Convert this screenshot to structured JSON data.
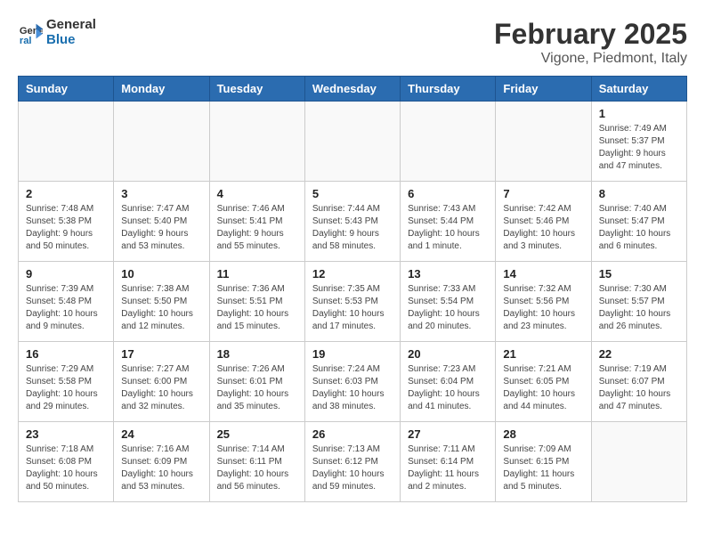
{
  "header": {
    "logo_line1": "General",
    "logo_line2": "Blue",
    "main_title": "February 2025",
    "subtitle": "Vigone, Piedmont, Italy"
  },
  "days_of_week": [
    "Sunday",
    "Monday",
    "Tuesday",
    "Wednesday",
    "Thursday",
    "Friday",
    "Saturday"
  ],
  "weeks": [
    [
      {
        "day": "",
        "info": ""
      },
      {
        "day": "",
        "info": ""
      },
      {
        "day": "",
        "info": ""
      },
      {
        "day": "",
        "info": ""
      },
      {
        "day": "",
        "info": ""
      },
      {
        "day": "",
        "info": ""
      },
      {
        "day": "1",
        "info": "Sunrise: 7:49 AM\nSunset: 5:37 PM\nDaylight: 9 hours and 47 minutes."
      }
    ],
    [
      {
        "day": "2",
        "info": "Sunrise: 7:48 AM\nSunset: 5:38 PM\nDaylight: 9 hours and 50 minutes."
      },
      {
        "day": "3",
        "info": "Sunrise: 7:47 AM\nSunset: 5:40 PM\nDaylight: 9 hours and 53 minutes."
      },
      {
        "day": "4",
        "info": "Sunrise: 7:46 AM\nSunset: 5:41 PM\nDaylight: 9 hours and 55 minutes."
      },
      {
        "day": "5",
        "info": "Sunrise: 7:44 AM\nSunset: 5:43 PM\nDaylight: 9 hours and 58 minutes."
      },
      {
        "day": "6",
        "info": "Sunrise: 7:43 AM\nSunset: 5:44 PM\nDaylight: 10 hours and 1 minute."
      },
      {
        "day": "7",
        "info": "Sunrise: 7:42 AM\nSunset: 5:46 PM\nDaylight: 10 hours and 3 minutes."
      },
      {
        "day": "8",
        "info": "Sunrise: 7:40 AM\nSunset: 5:47 PM\nDaylight: 10 hours and 6 minutes."
      }
    ],
    [
      {
        "day": "9",
        "info": "Sunrise: 7:39 AM\nSunset: 5:48 PM\nDaylight: 10 hours and 9 minutes."
      },
      {
        "day": "10",
        "info": "Sunrise: 7:38 AM\nSunset: 5:50 PM\nDaylight: 10 hours and 12 minutes."
      },
      {
        "day": "11",
        "info": "Sunrise: 7:36 AM\nSunset: 5:51 PM\nDaylight: 10 hours and 15 minutes."
      },
      {
        "day": "12",
        "info": "Sunrise: 7:35 AM\nSunset: 5:53 PM\nDaylight: 10 hours and 17 minutes."
      },
      {
        "day": "13",
        "info": "Sunrise: 7:33 AM\nSunset: 5:54 PM\nDaylight: 10 hours and 20 minutes."
      },
      {
        "day": "14",
        "info": "Sunrise: 7:32 AM\nSunset: 5:56 PM\nDaylight: 10 hours and 23 minutes."
      },
      {
        "day": "15",
        "info": "Sunrise: 7:30 AM\nSunset: 5:57 PM\nDaylight: 10 hours and 26 minutes."
      }
    ],
    [
      {
        "day": "16",
        "info": "Sunrise: 7:29 AM\nSunset: 5:58 PM\nDaylight: 10 hours and 29 minutes."
      },
      {
        "day": "17",
        "info": "Sunrise: 7:27 AM\nSunset: 6:00 PM\nDaylight: 10 hours and 32 minutes."
      },
      {
        "day": "18",
        "info": "Sunrise: 7:26 AM\nSunset: 6:01 PM\nDaylight: 10 hours and 35 minutes."
      },
      {
        "day": "19",
        "info": "Sunrise: 7:24 AM\nSunset: 6:03 PM\nDaylight: 10 hours and 38 minutes."
      },
      {
        "day": "20",
        "info": "Sunrise: 7:23 AM\nSunset: 6:04 PM\nDaylight: 10 hours and 41 minutes."
      },
      {
        "day": "21",
        "info": "Sunrise: 7:21 AM\nSunset: 6:05 PM\nDaylight: 10 hours and 44 minutes."
      },
      {
        "day": "22",
        "info": "Sunrise: 7:19 AM\nSunset: 6:07 PM\nDaylight: 10 hours and 47 minutes."
      }
    ],
    [
      {
        "day": "23",
        "info": "Sunrise: 7:18 AM\nSunset: 6:08 PM\nDaylight: 10 hours and 50 minutes."
      },
      {
        "day": "24",
        "info": "Sunrise: 7:16 AM\nSunset: 6:09 PM\nDaylight: 10 hours and 53 minutes."
      },
      {
        "day": "25",
        "info": "Sunrise: 7:14 AM\nSunset: 6:11 PM\nDaylight: 10 hours and 56 minutes."
      },
      {
        "day": "26",
        "info": "Sunrise: 7:13 AM\nSunset: 6:12 PM\nDaylight: 10 hours and 59 minutes."
      },
      {
        "day": "27",
        "info": "Sunrise: 7:11 AM\nSunset: 6:14 PM\nDaylight: 11 hours and 2 minutes."
      },
      {
        "day": "28",
        "info": "Sunrise: 7:09 AM\nSunset: 6:15 PM\nDaylight: 11 hours and 5 minutes."
      },
      {
        "day": "",
        "info": ""
      }
    ]
  ]
}
